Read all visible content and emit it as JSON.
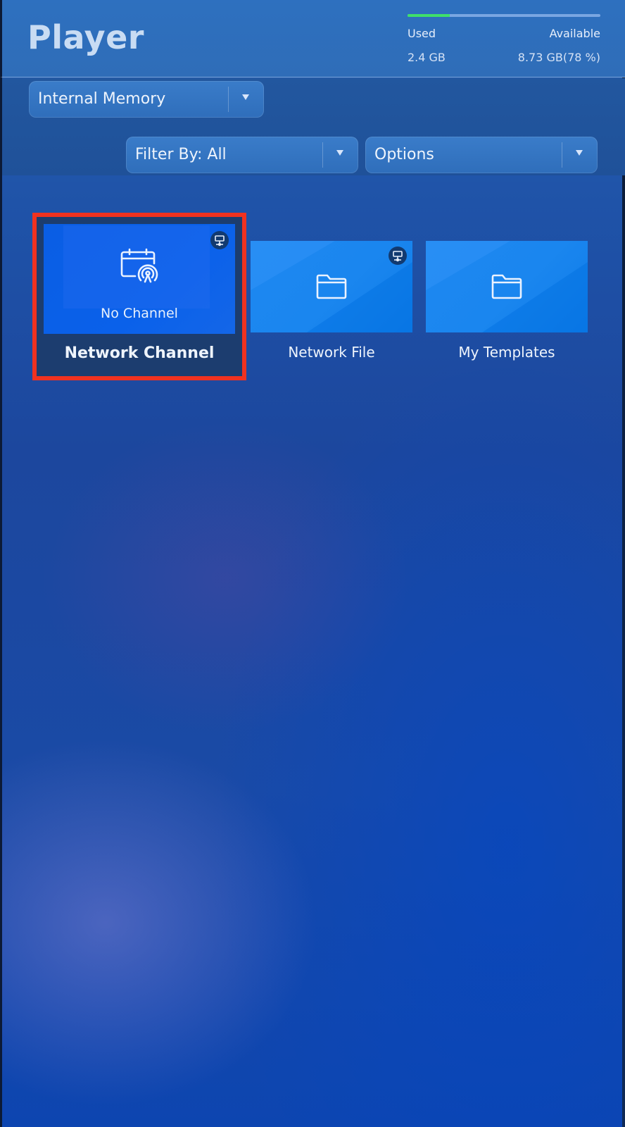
{
  "header": {
    "title": "Player"
  },
  "storage": {
    "used_label": "Used",
    "available_label": "Available",
    "used_value": "2.4 GB",
    "available_value": "8.73 GB(78 %)",
    "used_fraction": 0.22,
    "bar_color": "#3fe06a"
  },
  "toolbar": {
    "memory_dropdown": "Internal Memory",
    "filter_dropdown": "Filter By: All",
    "options_dropdown": "Options"
  },
  "tiles": [
    {
      "label": "Network Channel",
      "subtitle": "No Channel",
      "icon": "calendar-broadcast-icon",
      "selected": true,
      "selection_color": "#f03220",
      "network_badge": "network-icon"
    },
    {
      "label": "Network File",
      "icon": "folder-icon",
      "network_badge": "network-icon"
    },
    {
      "label": "My Templates",
      "icon": "folder-icon"
    }
  ]
}
